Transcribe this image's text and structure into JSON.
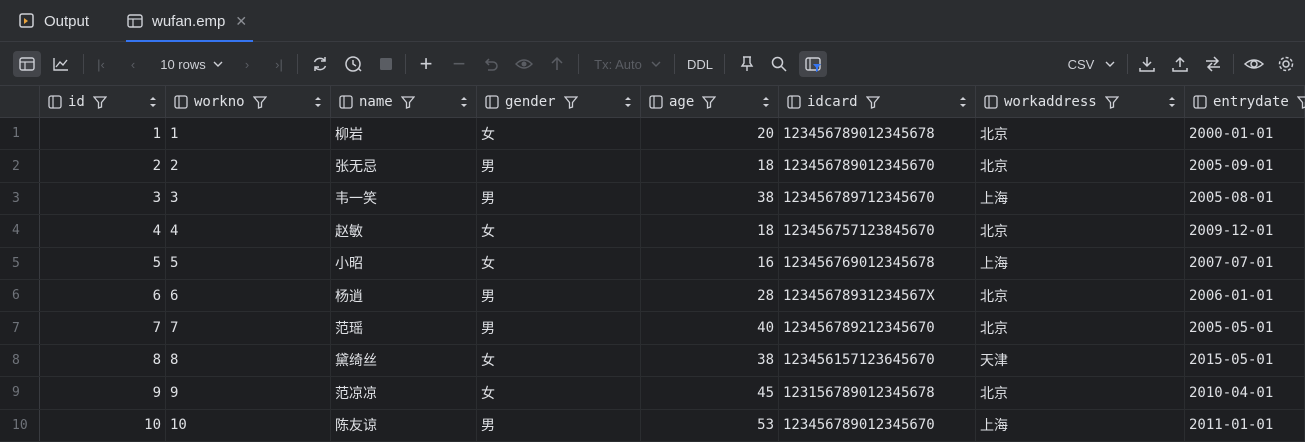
{
  "tabs": [
    {
      "label": "Output",
      "icon": "output-icon",
      "active": false
    },
    {
      "label": "wufan.emp",
      "icon": "table-icon",
      "active": true
    }
  ],
  "toolbar": {
    "rows_label": "10 rows",
    "tx_label": "Tx: Auto",
    "ddl_label": "DDL",
    "export_format": "CSV"
  },
  "columns": [
    "id",
    "workno",
    "name",
    "gender",
    "age",
    "idcard",
    "workaddress",
    "entrydate"
  ],
  "rows": [
    {
      "n": "1",
      "id": "1",
      "workno": "1",
      "name": "柳岩",
      "gender": "女",
      "age": "20",
      "idcard": "123456789012345678",
      "workaddress": "北京",
      "entrydate": "2000-01-01"
    },
    {
      "n": "2",
      "id": "2",
      "workno": "2",
      "name": "张无忌",
      "gender": "男",
      "age": "18",
      "idcard": "123456789012345670",
      "workaddress": "北京",
      "entrydate": "2005-09-01"
    },
    {
      "n": "3",
      "id": "3",
      "workno": "3",
      "name": "韦一笑",
      "gender": "男",
      "age": "38",
      "idcard": "123456789712345670",
      "workaddress": "上海",
      "entrydate": "2005-08-01"
    },
    {
      "n": "4",
      "id": "4",
      "workno": "4",
      "name": "赵敏",
      "gender": "女",
      "age": "18",
      "idcard": "123456757123845670",
      "workaddress": "北京",
      "entrydate": "2009-12-01"
    },
    {
      "n": "5",
      "id": "5",
      "workno": "5",
      "name": "小昭",
      "gender": "女",
      "age": "16",
      "idcard": "123456769012345678",
      "workaddress": "上海",
      "entrydate": "2007-07-01"
    },
    {
      "n": "6",
      "id": "6",
      "workno": "6",
      "name": "杨逍",
      "gender": "男",
      "age": "28",
      "idcard": "12345678931234567X",
      "workaddress": "北京",
      "entrydate": "2006-01-01"
    },
    {
      "n": "7",
      "id": "7",
      "workno": "7",
      "name": "范瑶",
      "gender": "男",
      "age": "40",
      "idcard": "123456789212345670",
      "workaddress": "北京",
      "entrydate": "2005-05-01"
    },
    {
      "n": "8",
      "id": "8",
      "workno": "8",
      "name": "黛绮丝",
      "gender": "女",
      "age": "38",
      "idcard": "123456157123645670",
      "workaddress": "天津",
      "entrydate": "2015-05-01"
    },
    {
      "n": "9",
      "id": "9",
      "workno": "9",
      "name": "范凉凉",
      "gender": "女",
      "age": "45",
      "idcard": "123156789012345678",
      "workaddress": "北京",
      "entrydate": "2010-04-01"
    },
    {
      "n": "10",
      "id": "10",
      "workno": "10",
      "name": "陈友谅",
      "gender": "男",
      "age": "53",
      "idcard": "123456789012345670",
      "workaddress": "上海",
      "entrydate": "2011-01-01"
    }
  ]
}
